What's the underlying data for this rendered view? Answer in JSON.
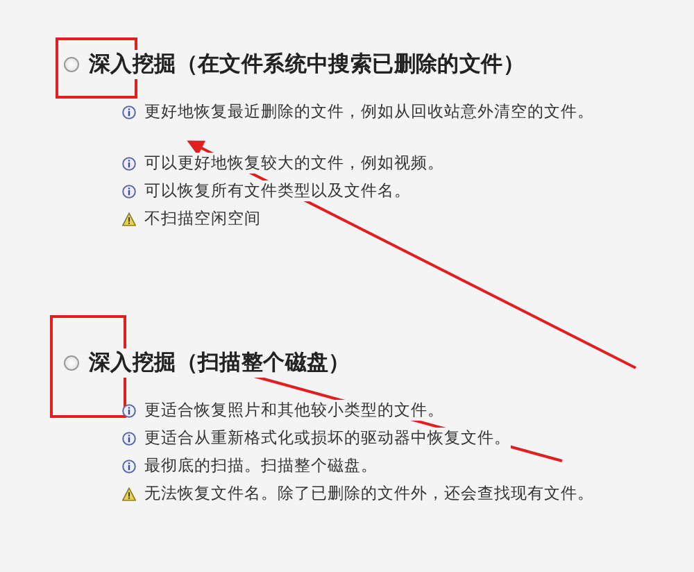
{
  "sections": [
    {
      "title": "深入挖掘（在文件系统中搜索已删除的文件）",
      "selected": false,
      "note_groups": [
        [
          {
            "kind": "info",
            "text": "更好地恢复最近删除的文件，例如从回收站意外清空的文件。"
          }
        ],
        [
          {
            "kind": "info",
            "text": "可以更好地恢复较大的文件，例如视频。"
          },
          {
            "kind": "info",
            "text": "可以恢复所有文件类型以及文件名。"
          },
          {
            "kind": "warning",
            "text": "不扫描空闲空间"
          }
        ]
      ]
    },
    {
      "title": "深入挖掘（扫描整个磁盘）",
      "selected": false,
      "note_groups": [
        [
          {
            "kind": "info",
            "text": "更适合恢复照片和其他较小类型的文件。"
          },
          {
            "kind": "info",
            "text": "更适合从重新格式化或损坏的驱动器中恢复文件。"
          },
          {
            "kind": "info",
            "text": "最彻底的扫描。扫描整个磁盘。"
          },
          {
            "kind": "warning",
            "text": "无法恢复文件名。除了已删除的文件外，还会查找现有文件。"
          }
        ]
      ]
    }
  ]
}
